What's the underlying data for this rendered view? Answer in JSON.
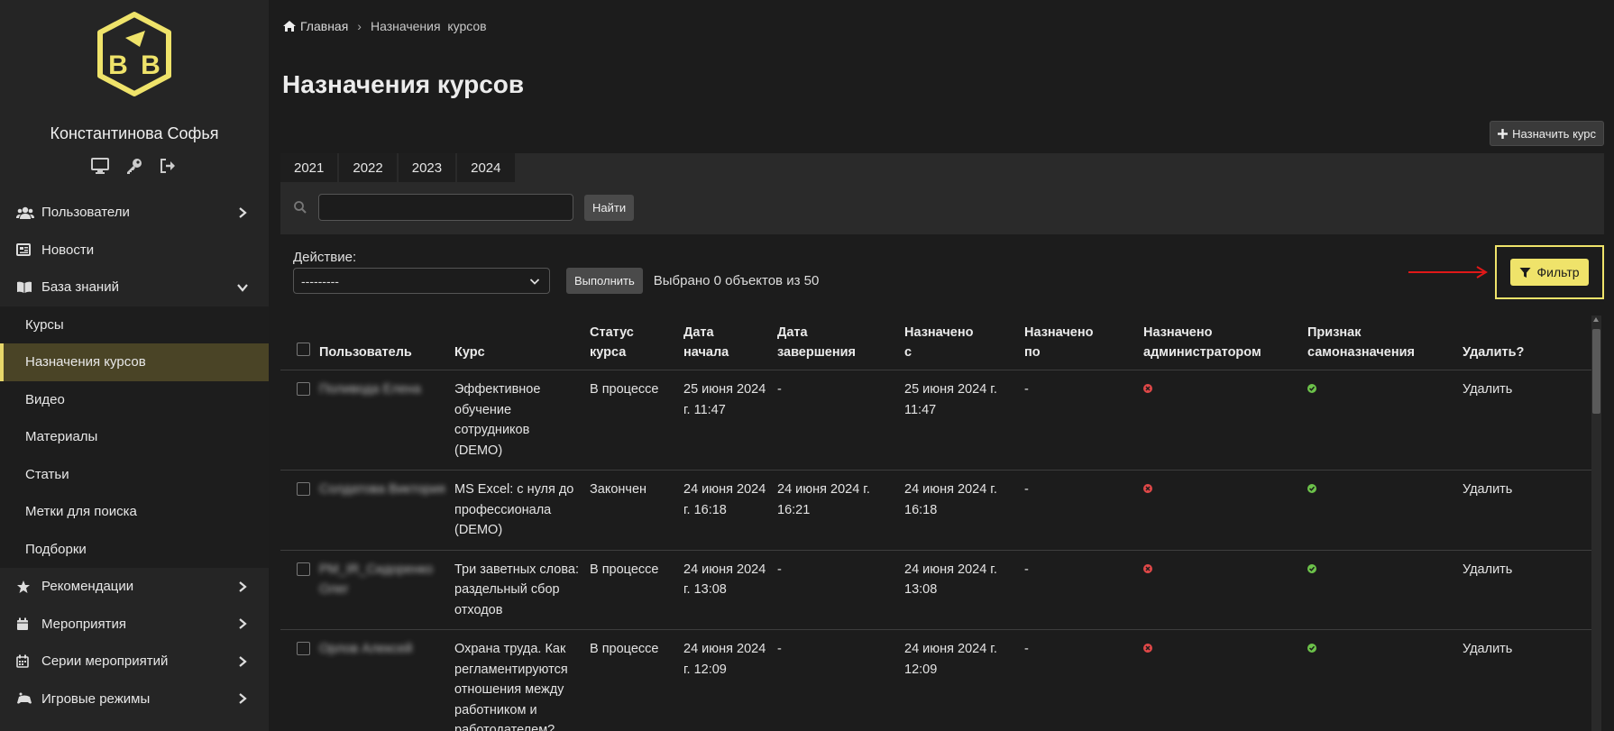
{
  "sidebar": {
    "user_name": "Константинова Софья",
    "user_icons": [
      "desktop-icon",
      "key-icon",
      "logout-icon"
    ],
    "items": [
      {
        "label": "Пользователи",
        "icon": "users-icon",
        "chevron": "right"
      },
      {
        "label": "Новости",
        "icon": "newspaper-icon",
        "chevron": ""
      },
      {
        "label": "База знаний",
        "icon": "book-icon",
        "chevron": "down"
      }
    ],
    "sub_items": [
      {
        "label": "Курсы"
      },
      {
        "label": "Назначения курсов",
        "active": true
      },
      {
        "label": "Видео"
      },
      {
        "label": "Материалы"
      },
      {
        "label": "Статьи"
      },
      {
        "label": "Метки для поиска"
      },
      {
        "label": "Подборки"
      }
    ],
    "items_after": [
      {
        "label": "Рекомендации",
        "icon": "star-icon"
      },
      {
        "label": "Мероприятия",
        "icon": "calendar-icon"
      },
      {
        "label": "Серии мероприятий",
        "icon": "calendar-grid-icon"
      },
      {
        "label": "Игровые режимы",
        "icon": "gamepad-icon"
      }
    ]
  },
  "breadcrumb": {
    "home": "Главная",
    "separator": "›",
    "current": "Назначения  курсов"
  },
  "page": {
    "title": "Назначения курсов",
    "assign_button": "Назначить курс"
  },
  "tabs": [
    "2021",
    "2022",
    "2023",
    "2024"
  ],
  "search": {
    "value": "",
    "button": "Найти"
  },
  "actions": {
    "label": "Действие:",
    "selected": "---------",
    "run_button": "Выполнить",
    "selected_info": "Выбрано 0 объектов из 50"
  },
  "filter": {
    "label": "Фильтр"
  },
  "table": {
    "headers": [
      "Пользователь",
      "Курс",
      "Статус\nкурса",
      "Дата\nначала",
      "Дата\nзавершения",
      "Назначено\nс",
      "Назначено\nпо",
      "Назначено\nадминистратором",
      "Признак\nсамоназначения",
      "Удалить?"
    ],
    "rows": [
      {
        "user": "Поливода Елена",
        "course": "Эффективное обучение сотрудников (DEMO)",
        "status": "В процессе",
        "start": "25 июня 2024 г. 11:47",
        "end": "-",
        "from": "25 июня 2024 г. 11:47",
        "to": "-",
        "admin": false,
        "self": true,
        "delete": "Удалить"
      },
      {
        "user": "Солдатова Виктория",
        "course": "MS Excel: с нуля до профессионала (DEMO)",
        "status": "Закончен",
        "start": "24 июня 2024 г. 16:18",
        "end": "24 июня 2024 г. 16:21",
        "from": "24 июня 2024 г. 16:18",
        "to": "-",
        "admin": false,
        "self": true,
        "delete": "Удалить"
      },
      {
        "user": "PM_IR_Сидоренко Олег",
        "course": "Три заветных слова: раздельный сбор отходов",
        "status": "В процессе",
        "start": "24 июня 2024 г. 13:08",
        "end": "-",
        "from": "24 июня 2024 г. 13:08",
        "to": "-",
        "admin": false,
        "self": true,
        "delete": "Удалить"
      },
      {
        "user": "Орлов Алексей",
        "course": "Охрана труда. Как регламентируются отношения между работником и работодателем?",
        "status": "В процессе",
        "start": "24 июня 2024 г. 12:09",
        "end": "-",
        "from": "24 июня 2024 г. 12:09",
        "to": "-",
        "admin": false,
        "self": true,
        "delete": "Удалить"
      }
    ]
  },
  "colors": {
    "accent": "#efe36a",
    "active_bg": "#4a4426",
    "no": "#e04848",
    "yes": "#6cc24a",
    "arrow": "#e01818"
  }
}
